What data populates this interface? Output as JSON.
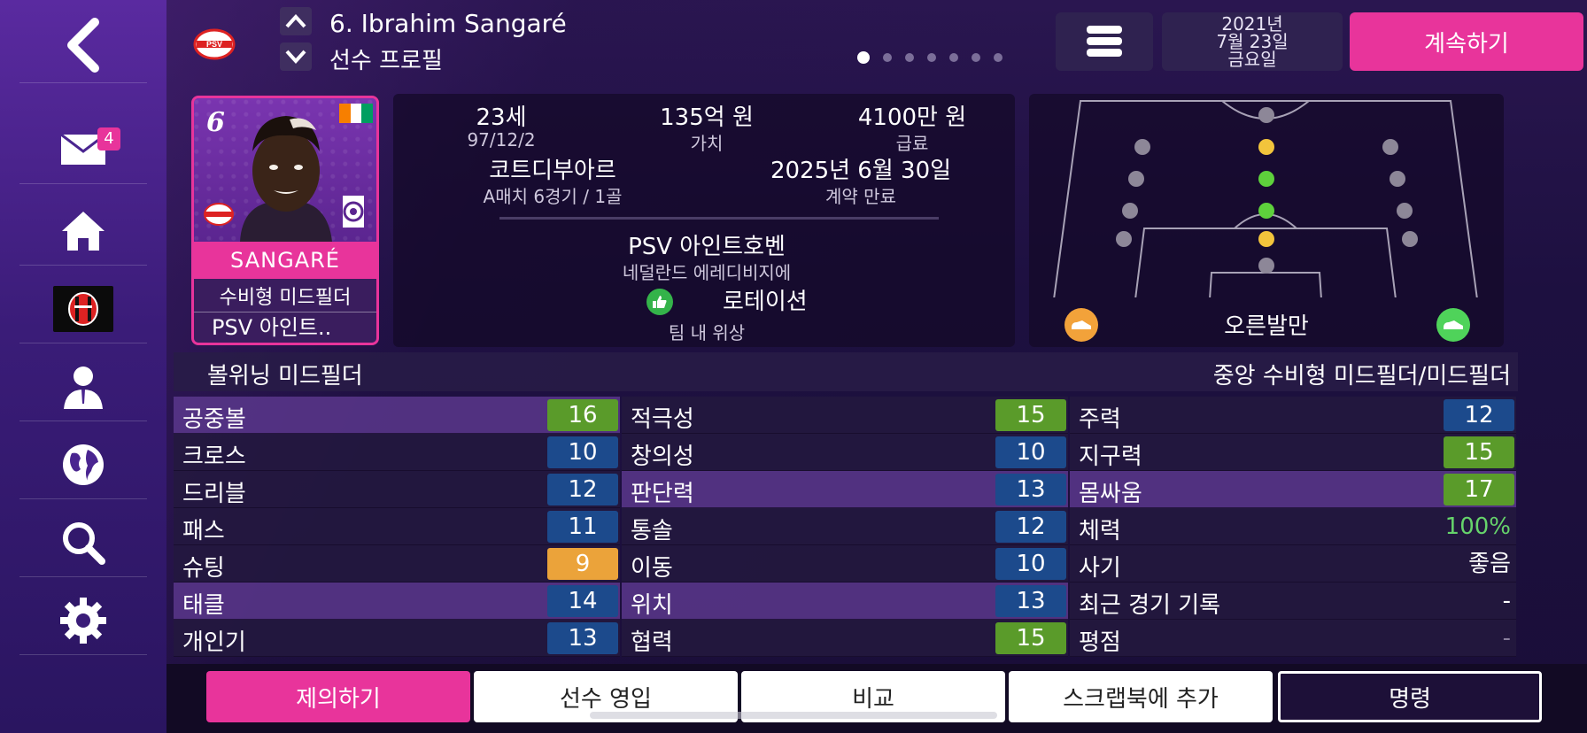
{
  "header": {
    "title": "6. Ibrahim Sangaré",
    "subtitle": "선수 프로필",
    "date": {
      "year": "2021년",
      "month_day": "7월 23일",
      "weekday": "금요일"
    },
    "continue_label": "계속하기",
    "page_count": 7,
    "active_page": 1
  },
  "sidebar": {
    "mail_badge": "4"
  },
  "card": {
    "number": "6",
    "name": "SANGARÉ",
    "position": "수비형 미드필더",
    "club": "PSV 아인트.."
  },
  "info": {
    "age": "23세",
    "dob": "97/12/2",
    "value": "135억 원",
    "value_label": "가치",
    "wage": "4100만 원",
    "wage_label": "급료",
    "nation": "코트디부아르",
    "caps": "A매치 6경기 / 1골",
    "contract": "2025년 6월 30일",
    "contract_label": "계약 만료",
    "club": "PSV 아인트호벤",
    "league": "네덜란드 에레디비지에",
    "status": "로테이션",
    "status_label": "팀 내 위상"
  },
  "pitch": {
    "foot": "오른발만"
  },
  "role": {
    "left": "볼위닝 미드필더",
    "right": "중앙 수비형 미드필더/미드필더"
  },
  "attributes": {
    "technical": [
      {
        "name": "공중볼",
        "value": "16",
        "style": "green",
        "hl": true
      },
      {
        "name": "크로스",
        "value": "10",
        "style": "blue",
        "hl": false
      },
      {
        "name": "드리블",
        "value": "12",
        "style": "blue",
        "hl": false
      },
      {
        "name": "패스",
        "value": "11",
        "style": "blue",
        "hl": false
      },
      {
        "name": "슈팅",
        "value": "9",
        "style": "orange",
        "hl": false
      },
      {
        "name": "태클",
        "value": "14",
        "style": "blue",
        "hl": true
      },
      {
        "name": "개인기",
        "value": "13",
        "style": "blue",
        "hl": false
      }
    ],
    "mental": [
      {
        "name": "적극성",
        "value": "15",
        "style": "green",
        "hl": false
      },
      {
        "name": "창의성",
        "value": "10",
        "style": "blue",
        "hl": false
      },
      {
        "name": "판단력",
        "value": "13",
        "style": "blue",
        "hl": true
      },
      {
        "name": "통솔",
        "value": "12",
        "style": "blue",
        "hl": false
      },
      {
        "name": "이동",
        "value": "10",
        "style": "blue",
        "hl": false
      },
      {
        "name": "위치",
        "value": "13",
        "style": "blue",
        "hl": true
      },
      {
        "name": "협력",
        "value": "15",
        "style": "green",
        "hl": false
      }
    ],
    "physical": [
      {
        "name": "주력",
        "value": "12",
        "style": "blue",
        "hl": false
      },
      {
        "name": "지구력",
        "value": "15",
        "style": "green",
        "hl": false
      },
      {
        "name": "몸싸움",
        "value": "17",
        "style": "green",
        "hl": true
      },
      {
        "name": "체력",
        "value": "100%",
        "style": "plain green-text",
        "hl": false
      },
      {
        "name": "사기",
        "value": "좋음",
        "style": "plain",
        "hl": false
      },
      {
        "name": "최근 경기 기록",
        "value": "-",
        "style": "plain",
        "hl": false
      },
      {
        "name": "평점",
        "value": "-",
        "style": "plain dim",
        "hl": false
      }
    ]
  },
  "bottom": {
    "offer": "제의하기",
    "transfer": "선수 영입",
    "compare": "비교",
    "scrapbook": "스크랩북에 추가",
    "command": "명령"
  },
  "colors": {
    "accent_pink": "#e8349b",
    "attr_blue": "#1c4a8c",
    "attr_green": "#5a9b2a",
    "attr_orange": "#eba33a"
  }
}
